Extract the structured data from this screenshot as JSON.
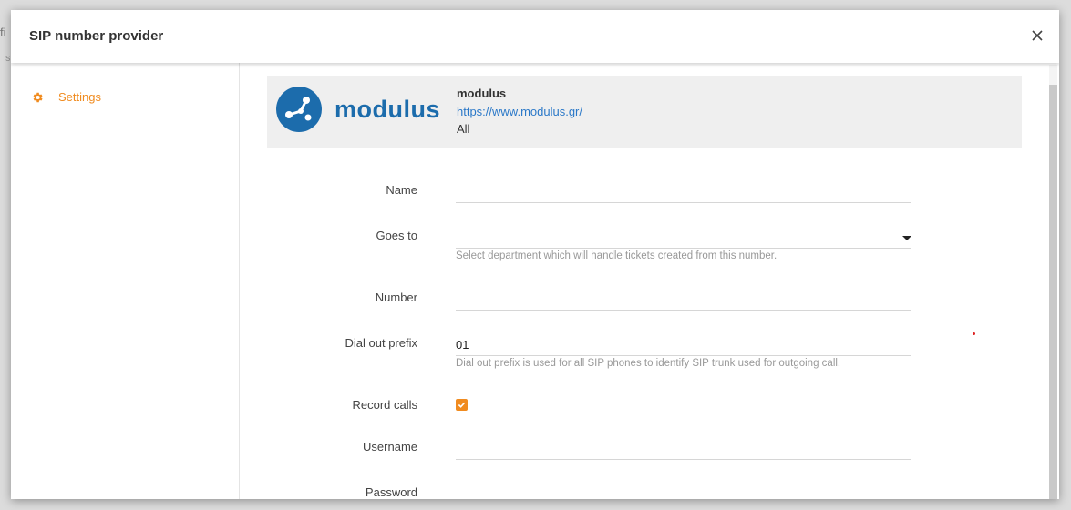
{
  "background": {
    "hint_top": "fi",
    "hint_small": "s"
  },
  "modal": {
    "title": "SIP number provider"
  },
  "sidebar": {
    "items": [
      {
        "label": "Settings",
        "icon": "gear-icon",
        "active": true
      }
    ]
  },
  "provider": {
    "logo_text": "modulus",
    "name": "modulus",
    "url": "https://www.modulus.gr/",
    "scope": "All"
  },
  "form": {
    "name": {
      "label": "Name",
      "value": ""
    },
    "goes_to": {
      "label": "Goes to",
      "value": "",
      "hint": "Select department which will handle tickets created from this number."
    },
    "number": {
      "label": "Number",
      "value": ""
    },
    "dial_out_prefix": {
      "label": "Dial out prefix",
      "value": "01",
      "hint": "Dial out prefix is used for all SIP phones to identify SIP trunk used for outgoing call."
    },
    "record_calls": {
      "label": "Record calls",
      "checked": true
    },
    "username": {
      "label": "Username",
      "value": ""
    },
    "password": {
      "label": "Password",
      "value": ""
    }
  },
  "colors": {
    "accent": "#f08b1f",
    "link": "#2a78c8",
    "brand": "#1c6cac"
  }
}
